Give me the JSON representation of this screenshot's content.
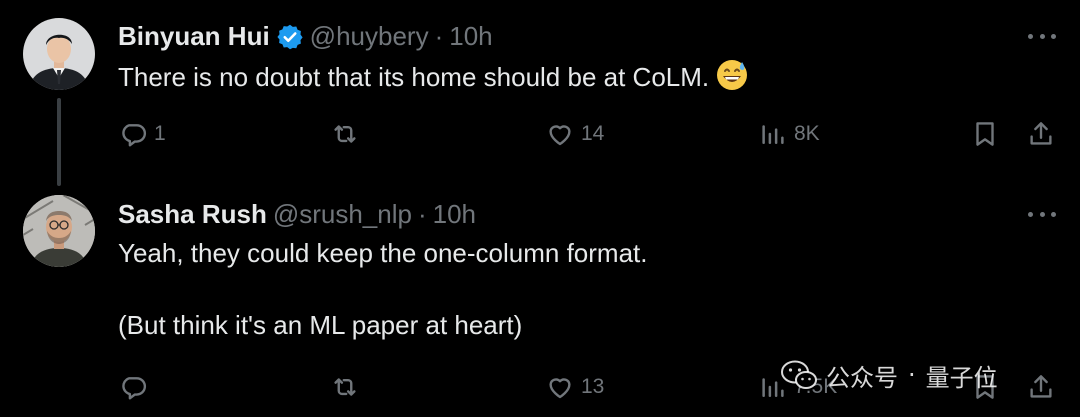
{
  "thread": [
    {
      "author": {
        "display_name": "Binyuan Hui",
        "verified": true,
        "handle": "@huybery",
        "time": "10h",
        "avatar": "avatar-photo-man-suit"
      },
      "separator": "·",
      "text": [
        "There is no doubt that its home should be at CoLM."
      ],
      "emoji": "grinning-face-with-sweat",
      "stats": {
        "replies": "1",
        "retweets": "",
        "likes": "14",
        "views": "8K"
      }
    },
    {
      "author": {
        "display_name": "Sasha Rush",
        "verified": false,
        "handle": "@srush_nlp",
        "time": "10h",
        "avatar": "avatar-photo-man-glasses"
      },
      "separator": "·",
      "text": [
        "Yeah, they could keep the one-column format.",
        "(But think it's an ML paper at heart)"
      ],
      "stats": {
        "replies": "",
        "retweets": "",
        "likes": "13",
        "views": "7.5K"
      }
    }
  ],
  "watermark": {
    "icon": "wechat-icon",
    "text_1": "公众号",
    "separator": "·",
    "text_2": "量子位"
  },
  "colors": {
    "background": "#000000",
    "primary_text": "#e7e9ea",
    "secondary_text": "#71767b",
    "verified_badge": "#1d9bf0",
    "thread_line": "#3a3f43"
  },
  "icons": {
    "reply": "reply-icon",
    "retweet": "retweet-icon",
    "like": "heart-icon",
    "views": "views-icon",
    "bookmark": "bookmark-icon",
    "share": "share-icon",
    "more": "more-options-icon"
  }
}
